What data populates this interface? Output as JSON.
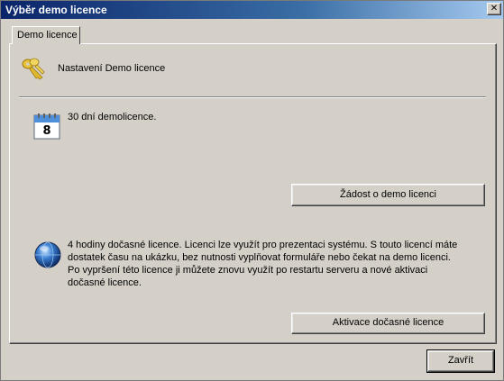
{
  "window": {
    "title": "Výběr demo licence",
    "close_glyph": "✕"
  },
  "tabs": [
    {
      "label": "Demo licence",
      "selected": true
    }
  ],
  "panel": {
    "header_icon": "keys-icon",
    "header_title": "Nastavení Demo licence",
    "demo_section": {
      "icon": "calendar-icon",
      "calendar_day": "8",
      "text": "30 dní demolicence.",
      "button_label": "Žádost o demo licenci"
    },
    "temporary_section": {
      "icon": "globe-icon",
      "text": "4 hodiny dočasné licence. Licenci lze využít pro prezentaci systému. S touto licencí máte dostatek času na ukázku, bez nutnosti vyplňovat formuláře nebo čekat na demo licenci. Po vypršení této licence ji můžete znovu využít po restartu serveru a nové aktivaci dočasné licence.",
      "button_label": "Aktivace dočasné licence"
    }
  },
  "footer": {
    "close_label": "Zavřít"
  },
  "colors": {
    "titlebar_start": "#0a246a",
    "titlebar_end": "#a6caf0",
    "face": "#d4d0c8"
  }
}
